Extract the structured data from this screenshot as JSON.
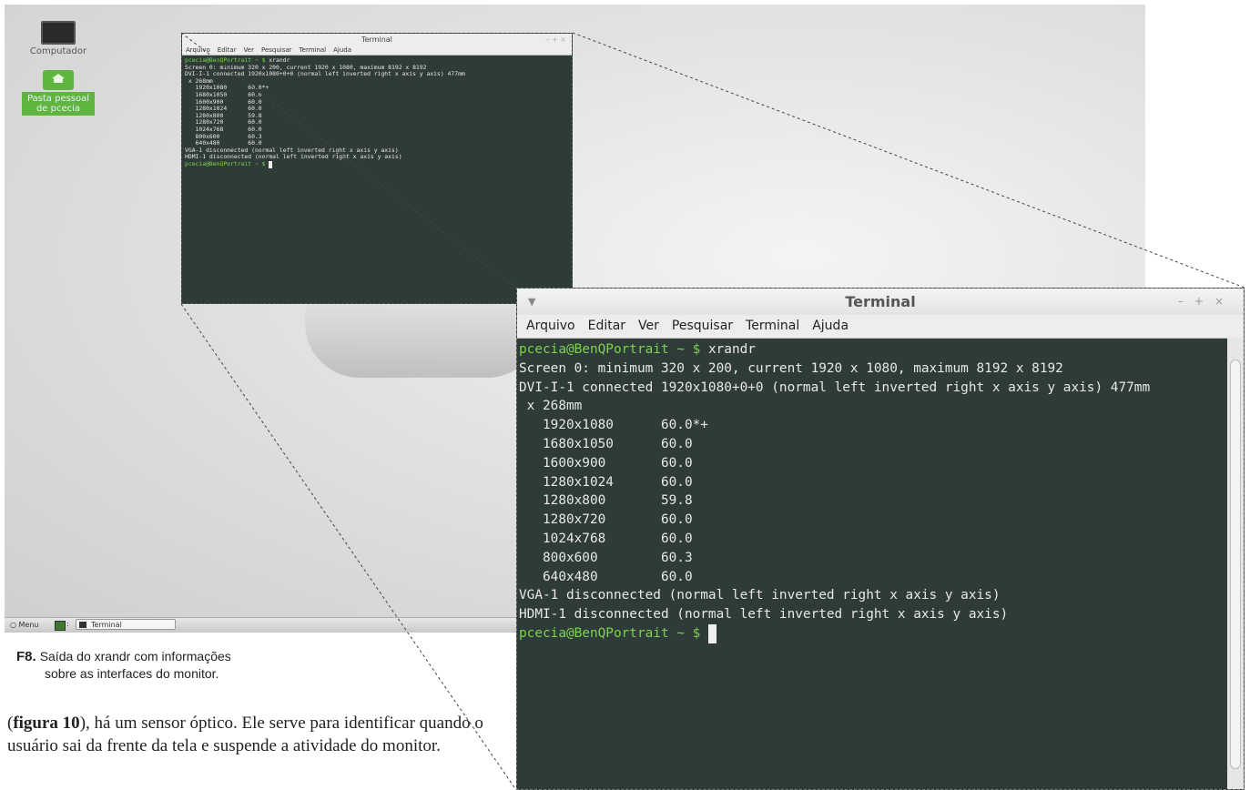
{
  "desktop": {
    "icons": [
      {
        "label": "Computador",
        "icon": "monitor-icon"
      },
      {
        "label": "Pasta pessoal de pcecia",
        "icon": "home-folder-icon"
      }
    ],
    "taskbar": {
      "menu_label": "Menu",
      "task_label": "Terminal"
    }
  },
  "terminal": {
    "title": "Terminal",
    "menu": [
      "Arquivo",
      "Editar",
      "Ver",
      "Pesquisar",
      "Terminal",
      "Ajuda"
    ],
    "prompt": "pcecia@BenQPortrait ~ $",
    "command": "xrandr",
    "output": [
      "Screen 0: minimum 320 x 200, current 1920 x 1080, maximum 8192 x 8192",
      "DVI-I-1 connected 1920x1080+0+0 (normal left inverted right x axis y axis) 477mm",
      " x 268mm",
      "   1920x1080      60.0*+",
      "   1680x1050      60.0",
      "   1600x900       60.0",
      "   1280x1024      60.0",
      "   1280x800       59.8",
      "   1280x720       60.0",
      "   1024x768       60.0",
      "   800x600        60.3",
      "   640x480        60.0",
      "VGA-1 disconnected (normal left inverted right x axis y axis)",
      "HDMI-1 disconnected (normal left inverted right x axis y axis)"
    ]
  },
  "caption": {
    "figure_label": "F8.",
    "line1": "Saída do xrandr com informações",
    "line2": "sobre as interfaces do monitor."
  },
  "article": {
    "figure_ref": "figura 10",
    "text_after_ref": "), há um sensor óptico. Ele serve para identificar quando o usuário sai da frente da tela e suspende a atividade do monitor."
  },
  "colors": {
    "terminal_bg": "#2f3b39",
    "prompt": "#7cd34c",
    "folder": "#5fb53f"
  }
}
